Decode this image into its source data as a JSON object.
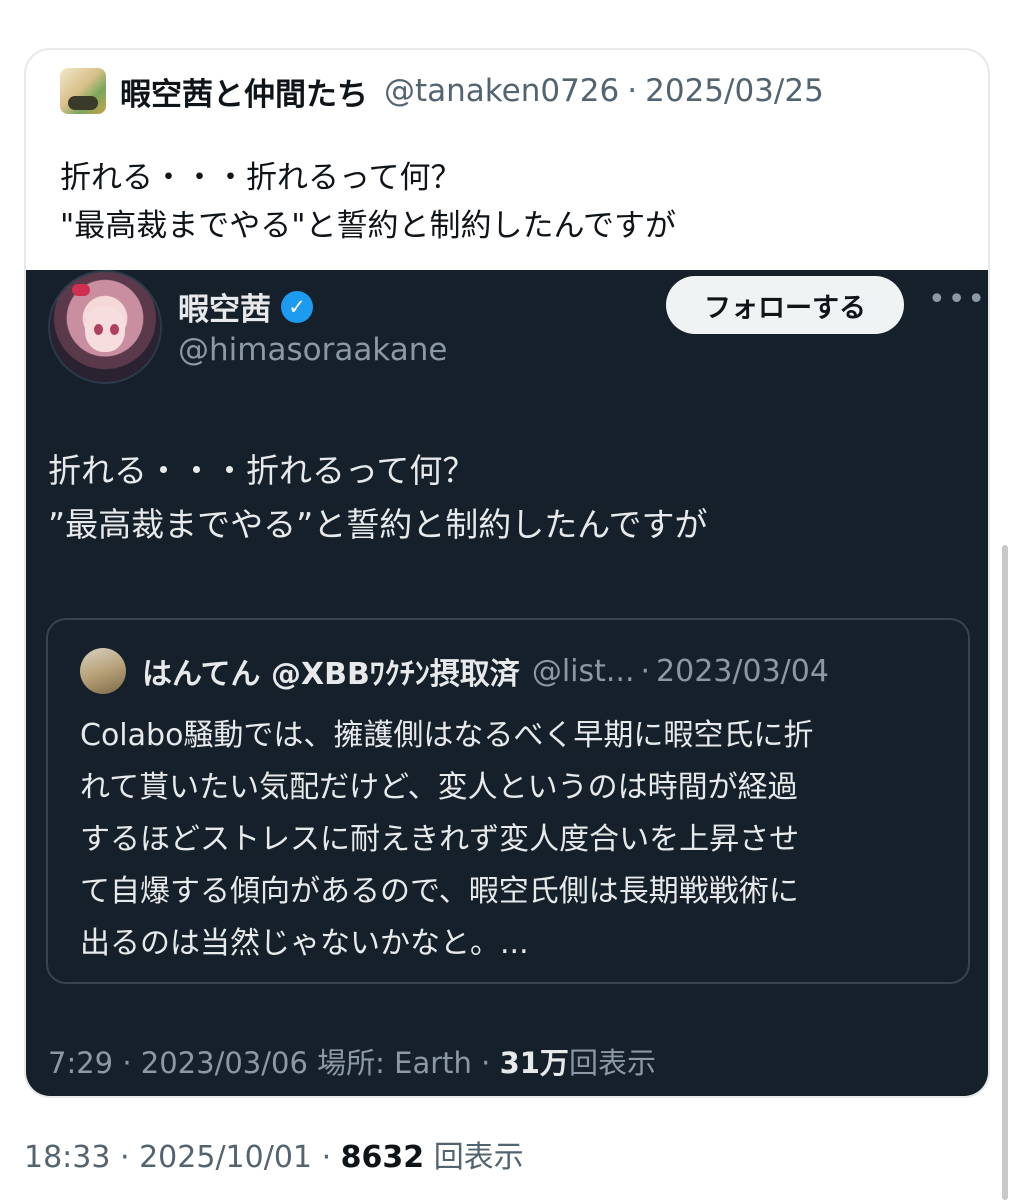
{
  "outer": {
    "name": "暇空茜と仲間たち",
    "handle": "@tanaken0726",
    "separator": "·",
    "date": "2025/03/25",
    "text_lines": [
      "折れる・・・折れるって何？",
      "\"最高裁までやる\"と誓約と制約したんですが"
    ]
  },
  "embedded": {
    "name": "暇空茜",
    "verified_icon": "verified-badge-icon",
    "handle": "@himasoraakane",
    "follow_label": "フォローする",
    "more_label": "•••",
    "text_lines": [
      "折れる・・・折れるって何？",
      "”最高裁までやる”と誓約と制約したんですが"
    ],
    "quote": {
      "name": "はんてん @XBBﾜｸﾁﾝ摂取済",
      "handle": "@list...",
      "separator": "·",
      "date": "2023/03/04",
      "text_lines": [
        "Colabo騒動では、擁護側はなるべく早期に暇空氏に折",
        "れて貰いたい気配だけど、変人というのは時間が経過",
        "するほどストレスに耐えきれず変人度合いを上昇させ",
        "て自爆する傾向があるので、暇空氏側は長期戦戦術に",
        "出るのは当然じゃないかなと。..."
      ]
    },
    "meta": {
      "time": "7:29",
      "date": "2023/03/06",
      "location": "場所: Earth",
      "views_count": "31万",
      "views_label": "回表示"
    }
  },
  "footer": {
    "time": "18:33",
    "date": "2025/10/01",
    "views_count": "8632",
    "views_label": "回表示"
  },
  "colors": {
    "dark_bg": "#15202b",
    "verified": "#1d9bf0",
    "muted": "#536471"
  }
}
